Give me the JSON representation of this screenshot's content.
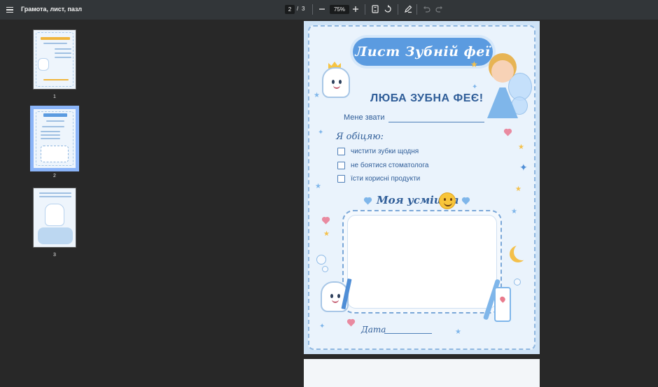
{
  "toolbar": {
    "doc_title": "Грамота, лист, пазл",
    "current_page": "2",
    "page_separator": "/",
    "total_pages": "3",
    "zoom": "75%",
    "icons": [
      "menu-icon",
      "zoom-out-icon",
      "zoom-in-icon",
      "fit-page-icon",
      "rotate-icon",
      "annotate-icon",
      "undo-icon",
      "redo-icon"
    ]
  },
  "thumbnails": [
    {
      "label": "1"
    },
    {
      "label": "2"
    },
    {
      "label": "3"
    }
  ],
  "sheet": {
    "title": "Лист Зубній феї",
    "heading": "ЛЮБА ЗУБНА ФЕЄ!",
    "name_label": "Мене звати",
    "promise_title": "Я обіцяю:",
    "promises": [
      "чистити зубки щодня",
      "не боятися стоматолога",
      "їсти корисні продукти"
    ],
    "smile_title": "Моя усмішка",
    "date_label": "Дата"
  },
  "colors": {
    "toolbar_bg": "#323639",
    "viewer_bg": "#282828",
    "selected_thumb": "#8ab4f8",
    "sheet_blue": "#2f5d98",
    "cloud_blue": "#5b9be0"
  }
}
